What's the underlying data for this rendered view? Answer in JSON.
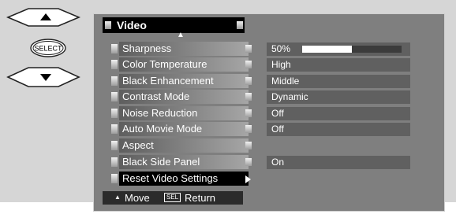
{
  "menu": {
    "title": "Video",
    "items": [
      {
        "label": "Sharpness",
        "value": "50%",
        "progress": 0.5
      },
      {
        "label": "Color Temperature",
        "value": "High"
      },
      {
        "label": "Black Enhancement",
        "value": "Middle"
      },
      {
        "label": "Contrast Mode",
        "value": "Dynamic"
      },
      {
        "label": "Noise Reduction",
        "value": "Off"
      },
      {
        "label": "Auto Movie Mode",
        "value": "Off"
      },
      {
        "label": "Aspect",
        "value": ""
      },
      {
        "label": "Black Side Panel",
        "value": "On"
      },
      {
        "label": "Reset Video Settings",
        "value": ""
      }
    ],
    "selected_index": 8
  },
  "footer": {
    "move_label": "Move",
    "sel_key": "SEL",
    "return_label": "Return"
  },
  "remote": {
    "select_label": "SELECT"
  },
  "colors": {
    "frame": "#7f7f7f",
    "value_bg": "#606060",
    "selected_bg": "#000000"
  }
}
